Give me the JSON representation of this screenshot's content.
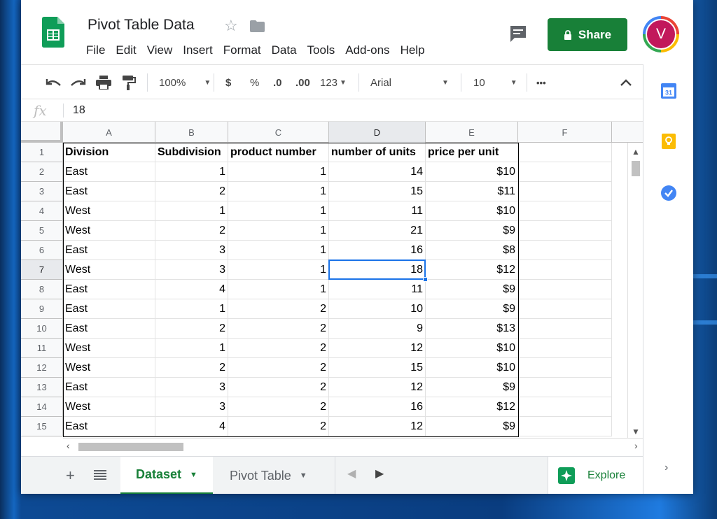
{
  "document": {
    "title": "Pivot Table Data",
    "menu": [
      "File",
      "Edit",
      "View",
      "Insert",
      "Format",
      "Data",
      "Tools",
      "Add-ons",
      "Help"
    ],
    "share_label": "Share",
    "avatar_initial": "V"
  },
  "toolbar": {
    "zoom": "100%",
    "currency": "$",
    "percent": "%",
    "decrease_decimal": ".0",
    "increase_decimal": ".00",
    "more_formats": "123",
    "font": "Arial",
    "font_size": "10",
    "more": "•••"
  },
  "formula_bar": {
    "fx": "fx",
    "value": "18"
  },
  "grid": {
    "columns": [
      "A",
      "B",
      "C",
      "D",
      "E",
      "F"
    ],
    "selected_column": "D",
    "selected_row": "7",
    "rows": [
      {
        "n": "1",
        "cells": [
          "Division",
          "Subdivision",
          "product number",
          "number of units",
          "price per unit"
        ]
      },
      {
        "n": "2",
        "cells": [
          "East",
          "1",
          "1",
          "14",
          "$10"
        ]
      },
      {
        "n": "3",
        "cells": [
          "East",
          "2",
          "1",
          "15",
          "$11"
        ]
      },
      {
        "n": "4",
        "cells": [
          "West",
          "1",
          "1",
          "11",
          "$10"
        ]
      },
      {
        "n": "5",
        "cells": [
          "West",
          "2",
          "1",
          "21",
          "$9"
        ]
      },
      {
        "n": "6",
        "cells": [
          "East",
          "3",
          "1",
          "16",
          "$8"
        ]
      },
      {
        "n": "7",
        "cells": [
          "West",
          "3",
          "1",
          "18",
          "$12"
        ]
      },
      {
        "n": "8",
        "cells": [
          "East",
          "4",
          "1",
          "11",
          "$9"
        ]
      },
      {
        "n": "9",
        "cells": [
          "East",
          "1",
          "2",
          "10",
          "$9"
        ]
      },
      {
        "n": "10",
        "cells": [
          "East",
          "2",
          "2",
          "9",
          "$13"
        ]
      },
      {
        "n": "11",
        "cells": [
          "West",
          "1",
          "2",
          "12",
          "$10"
        ]
      },
      {
        "n": "12",
        "cells": [
          "West",
          "2",
          "2",
          "15",
          "$10"
        ]
      },
      {
        "n": "13",
        "cells": [
          "East",
          "3",
          "2",
          "12",
          "$9"
        ]
      },
      {
        "n": "14",
        "cells": [
          "West",
          "3",
          "2",
          "16",
          "$12"
        ]
      },
      {
        "n": "15",
        "cells": [
          "East",
          "4",
          "2",
          "12",
          "$9"
        ]
      }
    ]
  },
  "sheets": {
    "tabs": [
      "Dataset",
      "Pivot Table"
    ],
    "active": "Dataset",
    "explore_label": "Explore"
  },
  "side_panel": {
    "calendar_day": "31",
    "icons": [
      "calendar-icon",
      "keep-icon",
      "tasks-icon"
    ]
  },
  "colors": {
    "sheets_green": "#188038",
    "selection_blue": "#1a73e8",
    "avatar_bg": "#c2185b"
  }
}
